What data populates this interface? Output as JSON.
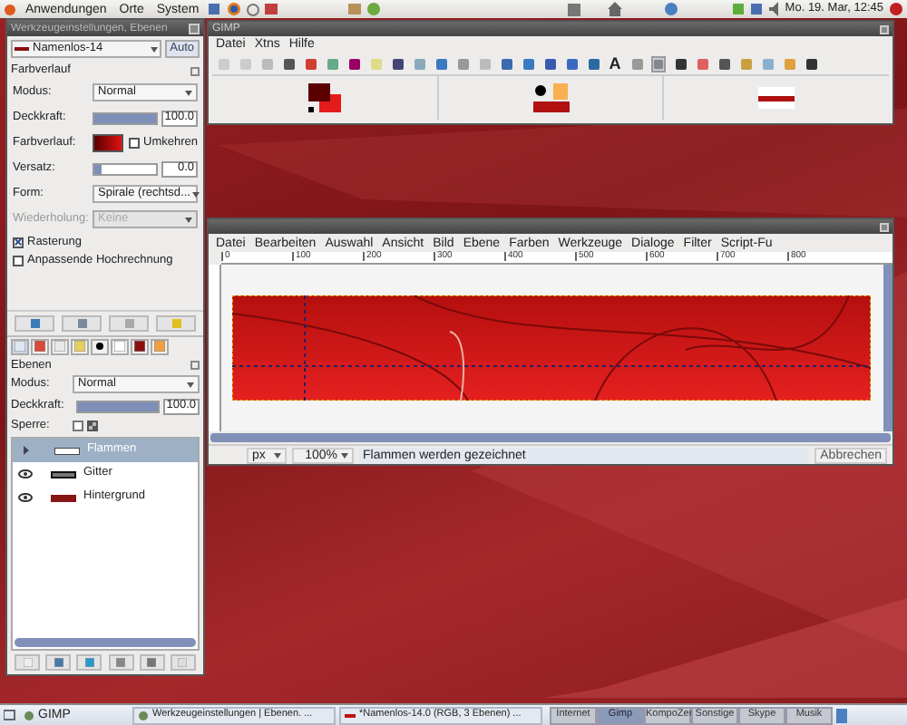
{
  "top_panel": {
    "menus": [
      "Anwendungen",
      "Orte",
      "System"
    ],
    "clock": "Mo. 19. Mar, 12:45"
  },
  "tool_options_window": {
    "title": "Werkzeugeinstellungen, Ebenen",
    "image_menu": "Namenlos-14",
    "auto_button": "Auto",
    "section": "Farbverlauf",
    "fields": [
      {
        "kind": "select",
        "label": "Modus:",
        "value": "Normal",
        "disabled": false
      },
      {
        "kind": "slider",
        "label": "Deckkraft:",
        "value": "100.0",
        "level": 1.0
      },
      {
        "kind": "gradient",
        "label": "Farbverlauf:",
        "check_label": "Umkehren",
        "checked": false
      },
      {
        "kind": "slider",
        "label": "Versatz:",
        "value": "0.0",
        "level": 0.0
      },
      {
        "kind": "select",
        "label": "Form:",
        "value": "Spirale (rechtsd...",
        "disabled": false
      },
      {
        "kind": "select",
        "label": "Wiederholung:",
        "value": "Keine",
        "disabled": true
      }
    ],
    "options": [
      {
        "label": "Rasterung",
        "checked": true
      },
      {
        "label": "Anpassende Hochrechnung",
        "checked": false
      }
    ]
  },
  "layers_panel": {
    "title": "Ebenen",
    "mode": {
      "label": "Modus:",
      "value": "Normal"
    },
    "opacity": {
      "label": "Deckkraft:",
      "value": "100.0",
      "level": 1.0
    },
    "lock_label": "Sperre:",
    "locked": false,
    "dock_tabs": [
      {
        "selected": true
      },
      {
        "selected": false
      },
      {
        "selected": false
      },
      {
        "selected": false
      },
      {
        "selected": false
      },
      {
        "selected": false
      },
      {
        "selected": false
      },
      {
        "selected": false
      }
    ],
    "layers": [
      {
        "name": "Flammen",
        "selected": true
      },
      {
        "name": "Gitter",
        "selected": false
      },
      {
        "name": "Hintergrund",
        "selected": false
      }
    ]
  },
  "toolbox": {
    "title": "GIMP",
    "menus": [
      "Datei",
      "Xtns",
      "Hilfe"
    ],
    "text_tool_glyph": "A"
  },
  "image_window": {
    "menus": [
      "Datei",
      "Bearbeiten",
      "Auswahl",
      "Ansicht",
      "Bild",
      "Ebene",
      "Farben",
      "Werkzeuge",
      "Dialoge",
      "Filter",
      "Script-Fu"
    ],
    "ruler_ticks": [
      "0",
      "100",
      "200",
      "300",
      "400",
      "500",
      "600",
      "700",
      "800"
    ],
    "unit": "px",
    "zoom": "100%",
    "message": "Flammen werden gezeichnet",
    "cancel_button": "Abbrechen"
  },
  "taskbar": {
    "start_label": "GIMP",
    "tasks": [
      {
        "label": "Werkzeugeinstellungen | Ebenen. ..."
      },
      {
        "label": "*Namenlos-14.0 (RGB, 3 Ebenen) ..."
      }
    ],
    "workspaces": [
      {
        "label": "Internet",
        "selected": false
      },
      {
        "label": "Gimp",
        "selected": true
      },
      {
        "label": "KompoZer",
        "selected": false
      },
      {
        "label": "Sonstige",
        "selected": false
      },
      {
        "label": "Skype",
        "selected": false
      },
      {
        "label": "Musik",
        "selected": false
      }
    ]
  }
}
